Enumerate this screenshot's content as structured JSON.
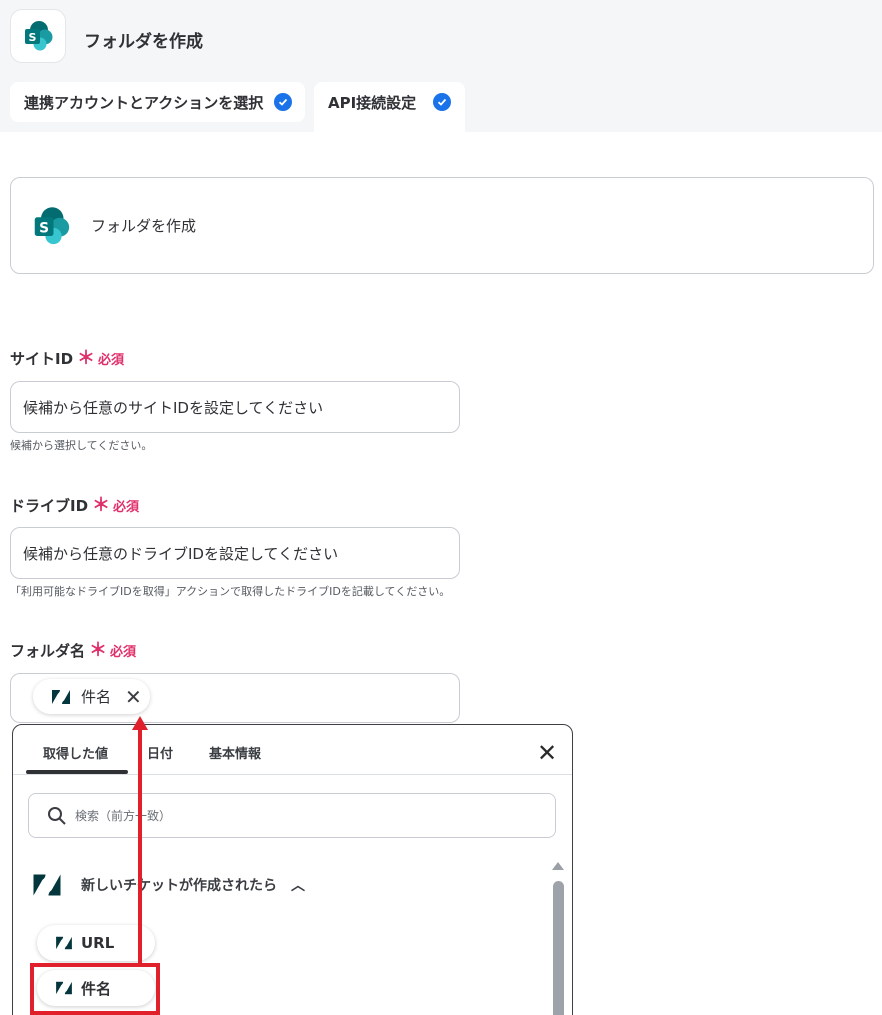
{
  "header": {
    "app_icon": "sharepoint-logo",
    "title": "フォルダを作成"
  },
  "steps": [
    {
      "label": "連携アカウントとアクションを選択",
      "status": "check-circle-icon"
    },
    {
      "label": "API接続設定",
      "status": "check-circle-icon"
    }
  ],
  "action_card": {
    "icon": "sharepoint-logo",
    "label": "フォルダを作成"
  },
  "fields": {
    "site_id": {
      "label": "サイトID",
      "required_mark": "＊",
      "required": "必須",
      "value": "候補から任意のサイトIDを設定してください",
      "help": "候補から選択してください。"
    },
    "drive_id": {
      "label": "ドライブID",
      "required_mark": "＊",
      "required": "必須",
      "value": "候補から任意のドライブIDを設定してください",
      "help": "「利用可能なドライブIDを取得」アクションで取得したドライブIDを記載してください。"
    },
    "folder_name": {
      "label": "フォルダ名",
      "required_mark": "＊",
      "required": "必須",
      "chip_label": "件名",
      "chip_icon": "zendesk-icon"
    }
  },
  "picker": {
    "tabs": [
      "取得した値",
      "日付",
      "基本情報"
    ],
    "active_tab": "取得した値",
    "search_placeholder": "検索（前方一致）",
    "section_title": "新しいチケットが作成されたら",
    "items": [
      {
        "label": "URL",
        "icon": "zendesk-icon"
      },
      {
        "label": "件名",
        "icon": "zendesk-icon",
        "highlighted": true
      }
    ]
  },
  "colors": {
    "accent": "#1a73e8",
    "required": "#e0306a",
    "annotation": "#e0202a",
    "sharepoint_dark": "#036c70",
    "sharepoint_teal": "#1a9ba1",
    "sharepoint_light": "#37c6d0"
  }
}
